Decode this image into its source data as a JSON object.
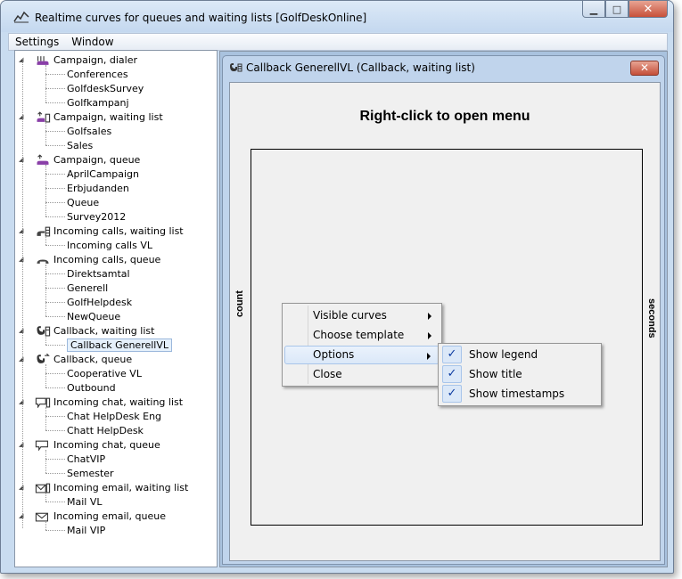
{
  "window": {
    "title": "Realtime curves for queues and waiting lists [GolfDeskOnline]",
    "minimize": "▁",
    "maximize": "□",
    "close": "✕"
  },
  "menubar": {
    "items": [
      "Settings",
      "Window"
    ]
  },
  "tree": {
    "groups": [
      {
        "label": "Campaign, dialer",
        "icon": "dialer-icon",
        "children": [
          "Conferences",
          "GolfdeskSurvey",
          "Golfkampanj"
        ]
      },
      {
        "label": "Campaign, waiting list",
        "icon": "campaign-waitlist-icon",
        "children": [
          "Golfsales",
          "Sales"
        ]
      },
      {
        "label": "Campaign, queue",
        "icon": "campaign-queue-icon",
        "children": [
          "AprilCampaign",
          "Erbjudanden",
          "Queue",
          "Survey2012"
        ]
      },
      {
        "label": "Incoming calls, waiting list",
        "icon": "phone-waitlist-icon",
        "children": [
          "Incoming calls VL"
        ]
      },
      {
        "label": "Incoming calls, queue",
        "icon": "phone-queue-icon",
        "children": [
          "Direktsamtal",
          "Generell",
          "GolfHelpdesk",
          "NewQueue"
        ]
      },
      {
        "label": "Callback, waiting list",
        "icon": "callback-waitlist-icon",
        "children": [
          "Callback GenerellVL"
        ]
      },
      {
        "label": "Callback, queue",
        "icon": "callback-queue-icon",
        "children": [
          "Cooperative VL",
          "Outbound"
        ]
      },
      {
        "label": "Incoming chat, waiting list",
        "icon": "chat-waitlist-icon",
        "children": [
          "Chat  HelpDesk Eng",
          "Chatt HelpDesk"
        ]
      },
      {
        "label": "Incoming chat, queue",
        "icon": "chat-queue-icon",
        "children": [
          "ChatVIP",
          "Semester"
        ]
      },
      {
        "label": "Incoming email, waiting list",
        "icon": "email-waitlist-icon",
        "children": [
          "Mail VL"
        ]
      },
      {
        "label": "Incoming email, queue",
        "icon": "email-queue-icon",
        "children": [
          "Mail VIP"
        ]
      }
    ],
    "selected": "Callback GenerellVL"
  },
  "child_window": {
    "title": "Callback GenerellVL (Callback, waiting list)",
    "close": "✕",
    "chart": {
      "title": "Right-click to open menu",
      "ylabel_left": "count",
      "ylabel_right": "seconds"
    }
  },
  "context_menu": {
    "items": [
      {
        "label": "Visible curves",
        "submenu": true
      },
      {
        "label": "Choose template",
        "submenu": true
      },
      {
        "label": "Options",
        "submenu": true,
        "highlighted": true
      },
      {
        "label": "Close",
        "submenu": false
      }
    ]
  },
  "options_submenu": {
    "items": [
      {
        "label": "Show legend",
        "checked": true
      },
      {
        "label": "Show title",
        "checked": true
      },
      {
        "label": "Show timestamps",
        "checked": true
      }
    ],
    "check_glyph": "✓"
  }
}
